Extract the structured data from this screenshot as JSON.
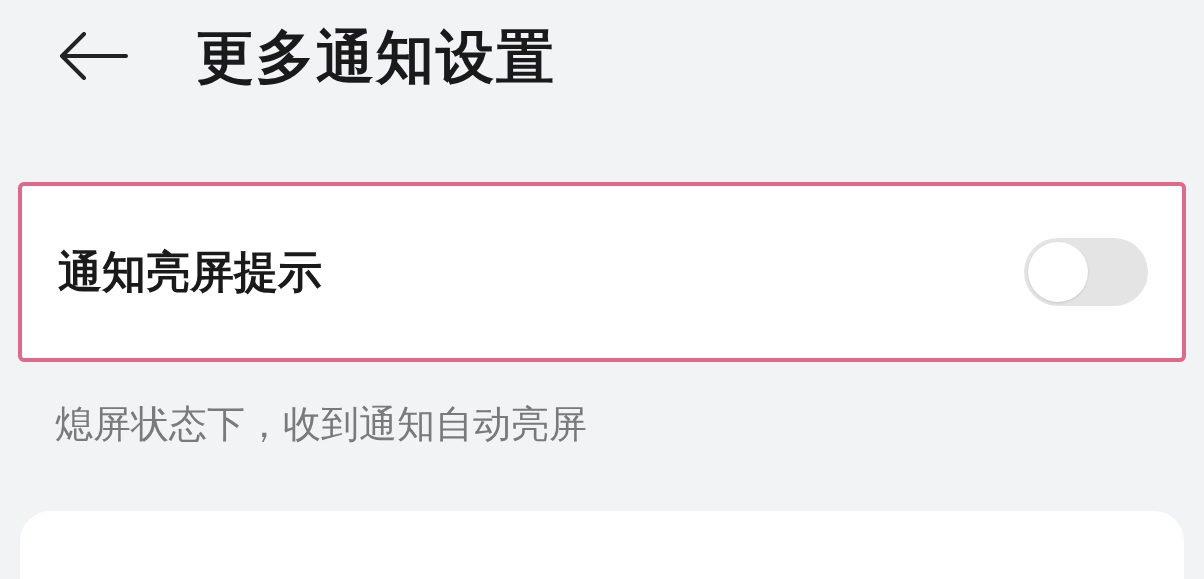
{
  "header": {
    "title": "更多通知设置"
  },
  "settings": [
    {
      "label": "通知亮屏提示",
      "on": false,
      "highlighted": true,
      "caption": "熄屏状态下，收到通知自动亮屏"
    }
  ]
}
